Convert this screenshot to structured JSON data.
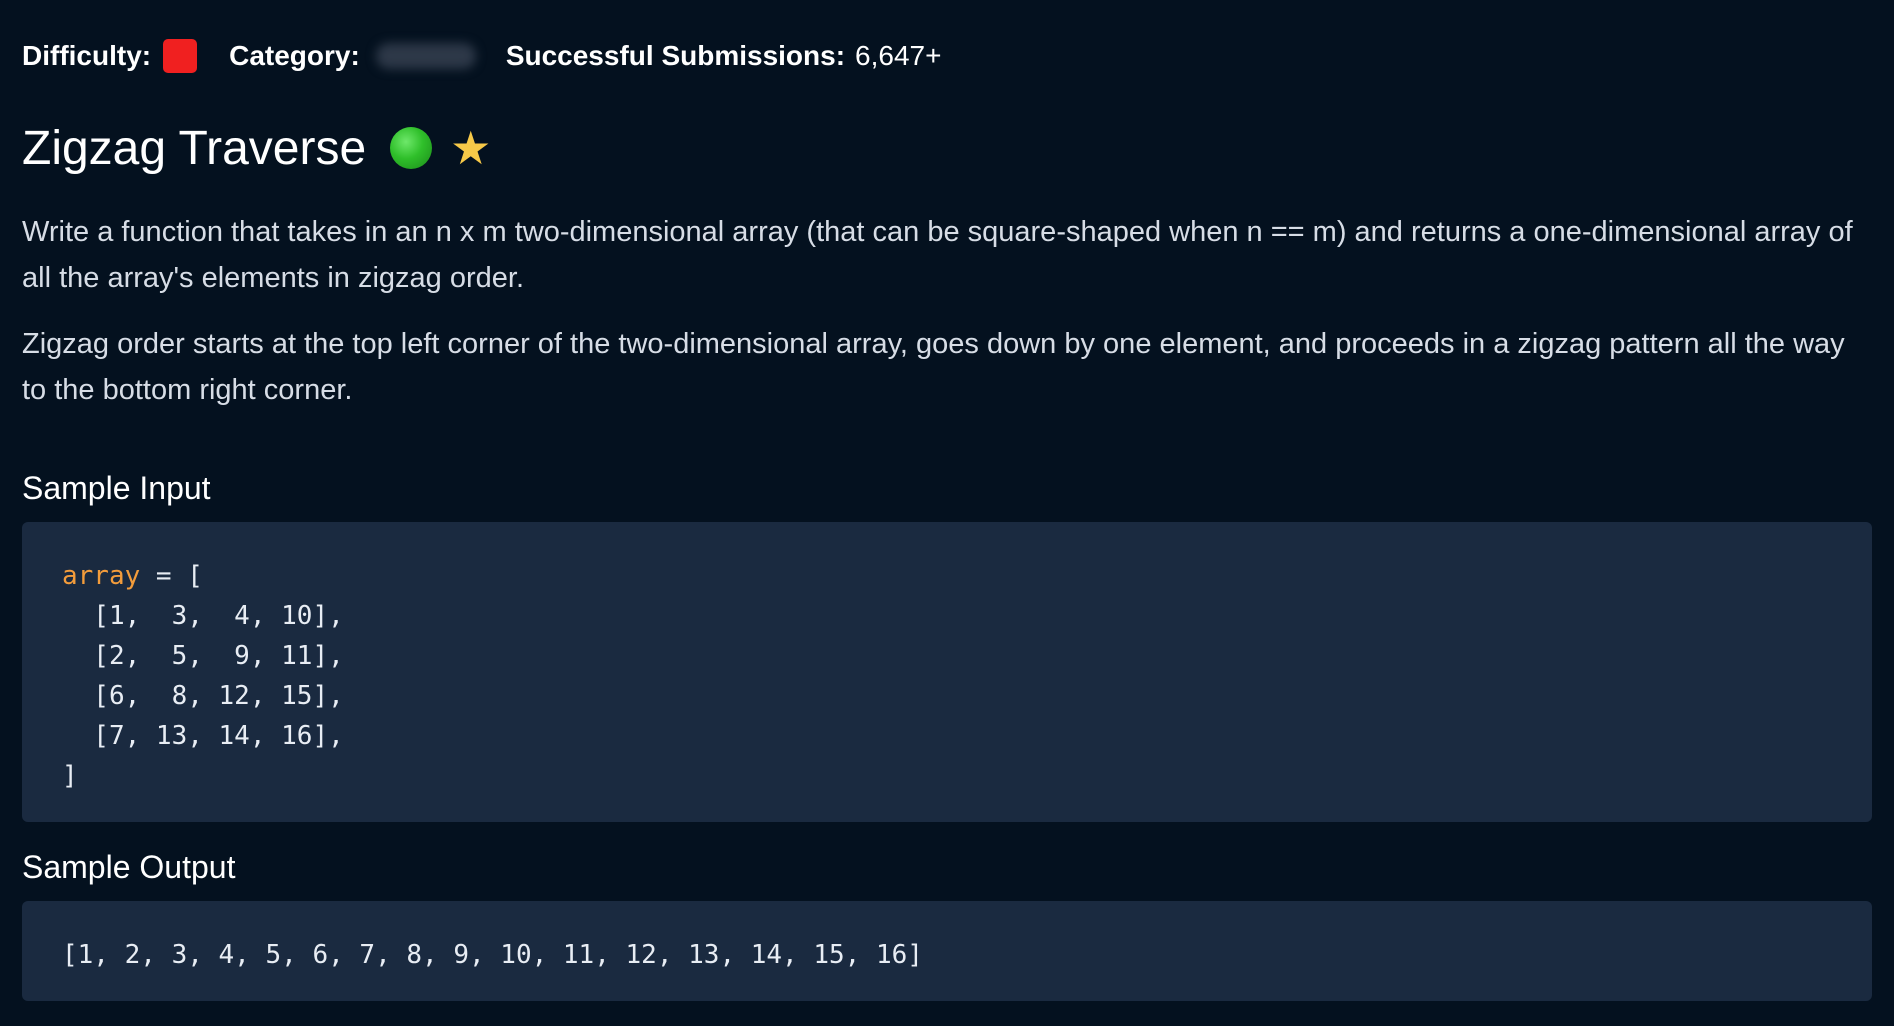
{
  "meta": {
    "difficulty_label": "Difficulty:",
    "difficulty_color": "#f02020",
    "category_label": "Category:",
    "submissions_label": "Successful Submissions:",
    "submissions_value": "6,647+"
  },
  "problem": {
    "title": "Zigzag Traverse",
    "status_icon": "green-circle-icon",
    "favorite_icon": "star-icon",
    "description": [
      "Write a function that takes in an n x m two-dimensional array (that can be square-shaped when n == m) and returns a one-dimensional array of all the array's elements in zigzag order.",
      "Zigzag order starts at the top left corner of the two-dimensional array, goes down by one element, and proceeds in a zigzag pattern all the way to the bottom right corner."
    ]
  },
  "sample_input": {
    "heading": "Sample Input",
    "variable": "array",
    "assign": " = [",
    "rows": [
      "  [1,  3,  4, 10],",
      "  [2,  5,  9, 11],",
      "  [6,  8, 12, 15],",
      "  [7, 13, 14, 16],"
    ],
    "closing": "]"
  },
  "sample_output": {
    "heading": "Sample Output",
    "value": "[1, 2, 3, 4, 5, 6, 7, 8, 9, 10, 11, 12, 13, 14, 15, 16]"
  },
  "colors": {
    "background": "#04111f",
    "code_background": "#1a2a40",
    "code_variable": "#f39c3b",
    "status_green": "#2fbf2a",
    "star_yellow": "#f7c948"
  }
}
